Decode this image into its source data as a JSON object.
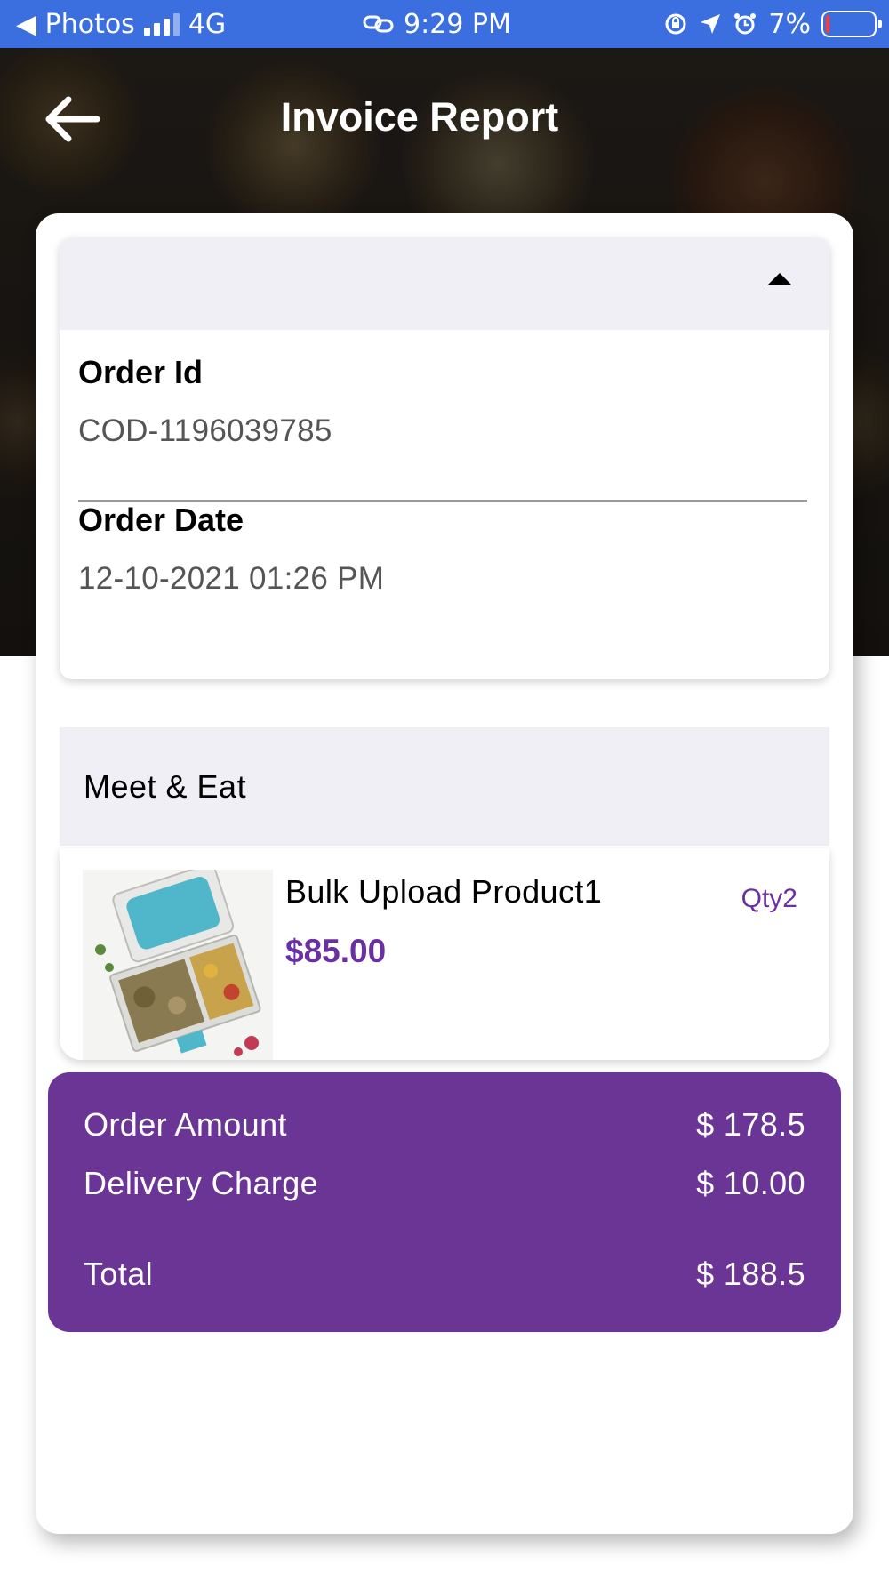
{
  "status_bar": {
    "back_app": "◀ Photos",
    "network": "4G",
    "time": "9:29 PM",
    "battery_percent": "7%",
    "battery_level": 0.07,
    "signal_bars": 3,
    "icons": [
      "link-icon",
      "rotation-lock-icon",
      "location-arrow-icon",
      "alarm-icon"
    ]
  },
  "header": {
    "title": "Invoice Report",
    "back_icon": "arrow-left-icon"
  },
  "order_details": {
    "order_id_label": "Order Id",
    "order_id": "COD-1196039785",
    "order_date_label": "Order Date",
    "order_date": "12-10-2021 01:26 PM",
    "toggle_icon": "caret-up-icon"
  },
  "vendor": {
    "name": "Meet & Eat"
  },
  "product": {
    "name": "Bulk Upload Product1",
    "price": "$85.00",
    "qty": "Qty2",
    "image_icon": "food-box-image"
  },
  "summary": {
    "order_amount_label": "Order Amount",
    "order_amount": "$ 178.5",
    "delivery_charge_label": "Delivery Charge",
    "delivery_charge": "$ 10.00",
    "total_label": "Total",
    "total": "$ 188.5"
  },
  "colors": {
    "status_bar": "#3b6fe0",
    "accent_purple": "#6a3595",
    "price_purple": "#6a2fa0",
    "panel_bg": "#f0eff6"
  }
}
